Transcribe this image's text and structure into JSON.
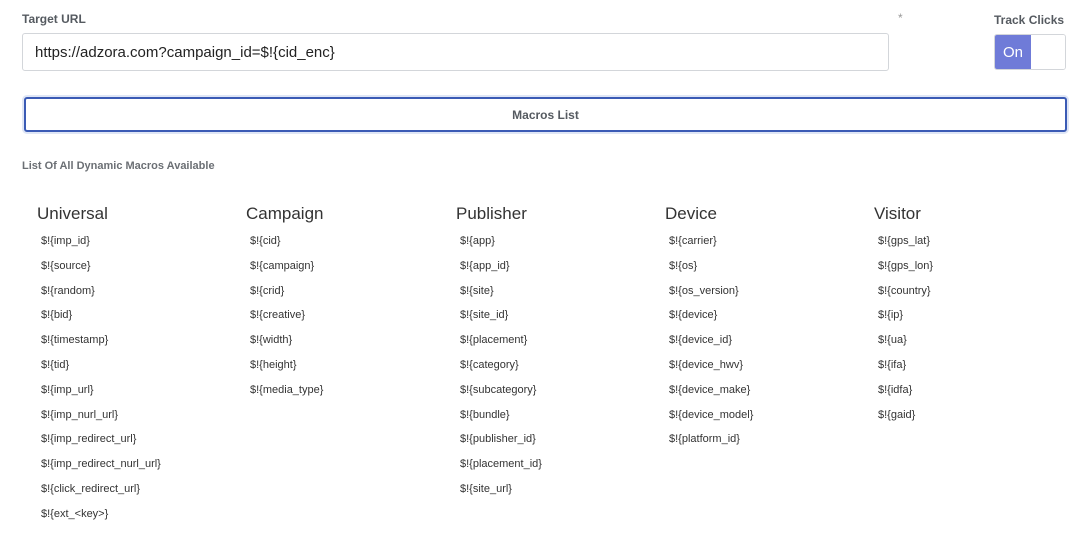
{
  "form": {
    "target_url_label": "Target URL",
    "required_mark": "*",
    "target_url_value": "https://adzora.com?campaign_id=$!{cid_enc}",
    "track_clicks_label": "Track Clicks",
    "track_clicks_state": "On",
    "toggle_accent": "#6f7bd8"
  },
  "macros_button": {
    "label": "Macros List",
    "border_color": "#3b5bb5"
  },
  "macros": {
    "title": "List Of All Dynamic Macros Available",
    "columns": [
      {
        "heading": "Universal",
        "items": [
          "$!{imp_id}",
          "$!{source}",
          "$!{random}",
          "$!{bid}",
          "$!{timestamp}",
          "$!{tid}",
          "$!{imp_url}",
          "$!{imp_nurl_url}",
          "$!{imp_redirect_url}",
          "$!{imp_redirect_nurl_url}",
          "$!{click_redirect_url}",
          "$!{ext_<key>}"
        ]
      },
      {
        "heading": "Campaign",
        "items": [
          "$!{cid}",
          "$!{campaign}",
          "$!{crid}",
          "$!{creative}",
          "$!{width}",
          "$!{height}",
          "$!{media_type}"
        ]
      },
      {
        "heading": "Publisher",
        "items": [
          "$!{app}",
          "$!{app_id}",
          "$!{site}",
          "$!{site_id}",
          "$!{placement}",
          "$!{category}",
          "$!{subcategory}",
          "$!{bundle}",
          "$!{publisher_id}",
          "$!{placement_id}",
          "$!{site_url}"
        ]
      },
      {
        "heading": "Device",
        "items": [
          "$!{carrier}",
          "$!{os}",
          "$!{os_version}",
          "$!{device}",
          "$!{device_id}",
          "$!{device_hwv}",
          "$!{device_make}",
          "$!{device_model}",
          "$!{platform_id}"
        ]
      },
      {
        "heading": "Visitor",
        "items": [
          "$!{gps_lat}",
          "$!{gps_lon}",
          "$!{country}",
          "$!{ip}",
          "$!{ua}",
          "$!{ifa}",
          "$!{idfa}",
          "$!{gaid}"
        ]
      }
    ]
  }
}
